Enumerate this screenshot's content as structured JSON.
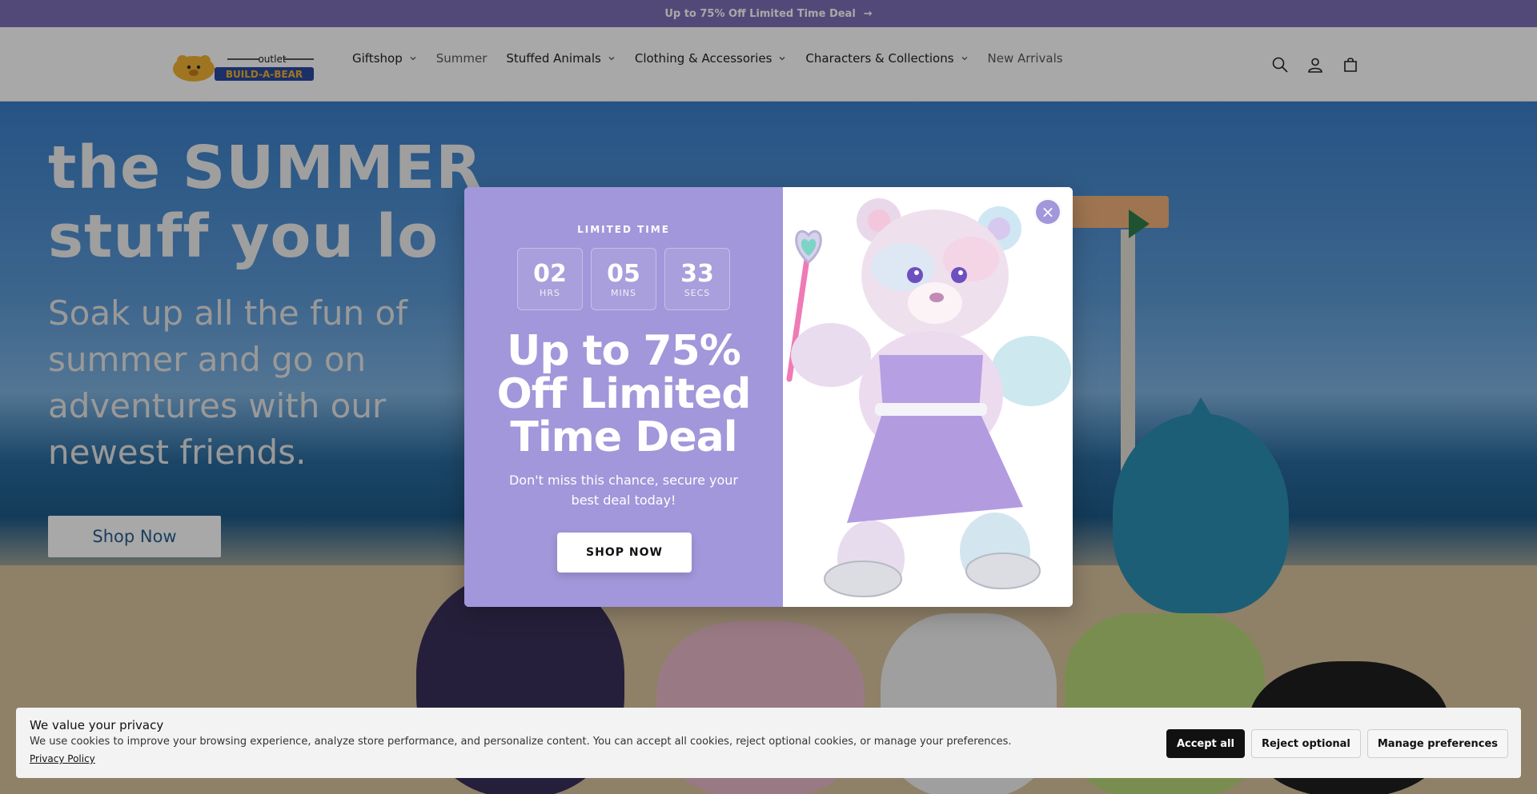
{
  "announcement": {
    "text": "Up to 75% Off Limited Time Deal",
    "arrow": "→"
  },
  "header": {
    "logo_text_top": "outlet",
    "logo_text_main": "BUILD-A-BEAR",
    "nav": [
      {
        "label": "Giftshop",
        "has_dropdown": true
      },
      {
        "label": "Summer",
        "has_dropdown": false
      },
      {
        "label": "Stuffed Animals",
        "has_dropdown": true
      },
      {
        "label": "Clothing & Accessories",
        "has_dropdown": true
      },
      {
        "label": "Characters & Collections",
        "has_dropdown": true
      },
      {
        "label": "New Arrivals",
        "has_dropdown": false
      }
    ],
    "icons": [
      "search-icon",
      "account-icon",
      "cart-icon"
    ]
  },
  "hero": {
    "title_line1": "the SUMMER",
    "title_line2": "stuff you lo",
    "subtitle": "Soak up all the fun of summer and go on adventures with our newest friends.",
    "button": "Shop Now"
  },
  "modal": {
    "eyebrow": "LIMITED TIME",
    "countdown": [
      {
        "value": "02",
        "label": "HRS"
      },
      {
        "value": "05",
        "label": "MINS"
      },
      {
        "value": "33",
        "label": "SECS"
      }
    ],
    "title": "Up to 75% Off Limited Time Deal",
    "subtitle": "Don't miss this chance, secure your best deal today!",
    "button": "SHOP NOW",
    "close_symbol": "×"
  },
  "cookie": {
    "title": "We value your privacy",
    "text": "We use cookies to improve your browsing experience, analyze store performance, and personalize content. You can accept all cookies, reject optional cookies, or manage your preferences.",
    "link": "Privacy Policy",
    "buttons": {
      "accept": "Accept all",
      "reject": "Reject optional",
      "manage": "Manage preferences"
    }
  },
  "colors": {
    "accent": "#a197da",
    "announcement_bg": "#7e6fb8"
  }
}
